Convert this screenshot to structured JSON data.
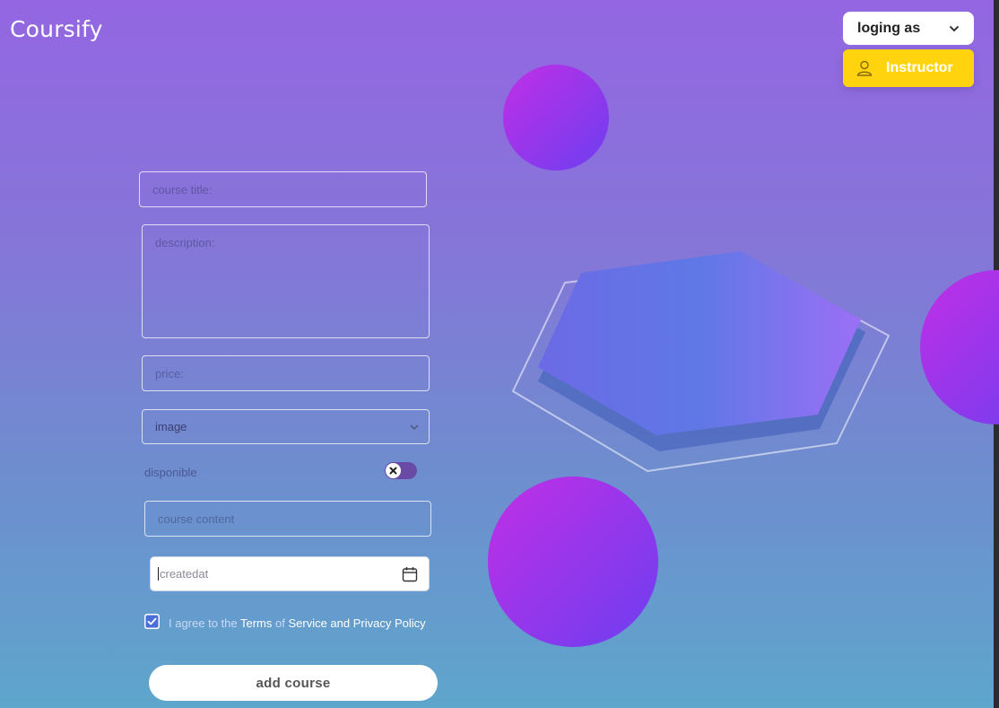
{
  "brand": {
    "name": "Coursify"
  },
  "header": {
    "login_select_label": "loging as",
    "role_button_label": "Instructor"
  },
  "form": {
    "title_placeholder": "course title:",
    "description_placeholder": "description:",
    "price_placeholder": "price:",
    "image_select_value": "image",
    "disponible_label": "disponible",
    "disponible_on": false,
    "content_placeholder": "course content",
    "createdat_placeholder": "createdat",
    "agree_checked": true,
    "agree": {
      "prefix": "I agree to the ",
      "terms": "Terms",
      "of": " of ",
      "service_policy": "Service and Privacy Policy"
    },
    "submit_label": "add course"
  },
  "icons": {
    "login_chevron": "chevron-down-icon",
    "role": "user-icon",
    "image_chevron": "chevron-down-icon",
    "toggle_off": "close-icon",
    "date": "calendar-icon",
    "checkbox": "check-icon"
  },
  "colors": {
    "accent_yellow": "#ffd40f",
    "toggle": "#6a4aa7",
    "checkbox": "#4a6fd8",
    "orb_start": "#c12fe6",
    "orb_end": "#6c3ef0"
  }
}
